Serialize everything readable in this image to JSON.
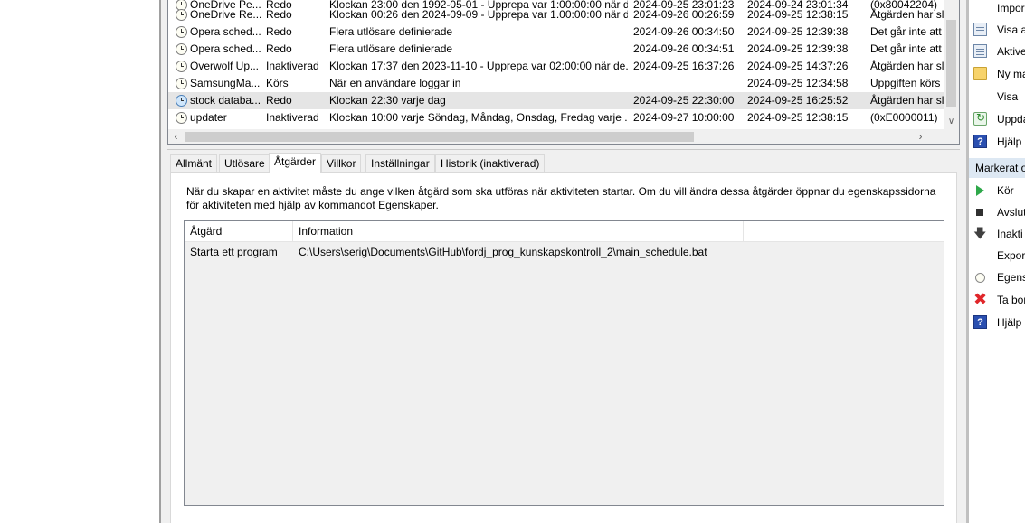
{
  "tasks": [
    {
      "name": "OneDrive Pe...",
      "status": "Redo",
      "trigger": "Klockan 23:00 den 1992-05-01 - Upprepa var 1:00:00:00 när di...",
      "next_run": "2024-09-25 23:01:23",
      "last_run": "2024-09-24 23:01:34",
      "result": "(0x80042204)",
      "selected": false,
      "icon": "clock-icon"
    },
    {
      "name": "OneDrive Re...",
      "status": "Redo",
      "trigger": "Klockan 00:26 den 2024-09-09 - Upprepa var 1.00:00:00 när d...",
      "next_run": "2024-09-26 00:26:59",
      "last_run": "2024-09-25 12:38:15",
      "result": "Åtgärden har sl",
      "selected": false,
      "icon": "clock-icon"
    },
    {
      "name": "Opera sched...",
      "status": "Redo",
      "trigger": "Flera utlösare definierade",
      "next_run": "2024-09-26 00:34:50",
      "last_run": "2024-09-25 12:39:38",
      "result": "Det går inte att",
      "selected": false,
      "icon": "clock-icon"
    },
    {
      "name": "Opera sched...",
      "status": "Redo",
      "trigger": "Flera utlösare definierade",
      "next_run": "2024-09-26 00:34:51",
      "last_run": "2024-09-25 12:39:38",
      "result": "Det går inte att",
      "selected": false,
      "icon": "clock-icon"
    },
    {
      "name": "Overwolf Up...",
      "status": "Inaktiverad",
      "trigger": "Klockan 17:37 den 2023-11-10 - Upprepa var 02:00:00 när de...",
      "next_run": "2024-09-25 16:37:26",
      "last_run": "2024-09-25 14:37:26",
      "result": "Åtgärden har sl",
      "selected": false,
      "icon": "clock-icon"
    },
    {
      "name": "SamsungMa...",
      "status": "Körs",
      "trigger": "När en användare loggar in",
      "next_run": "",
      "last_run": "2024-09-25 12:34:58",
      "result": "Uppgiften körs",
      "selected": false,
      "icon": "clock-icon"
    },
    {
      "name": "stock databa...",
      "status": "Redo",
      "trigger": "Klockan 22:30 varje dag",
      "next_run": "2024-09-25 22:30:00",
      "last_run": "2024-09-25 16:25:52",
      "result": "Åtgärden har sl",
      "selected": true,
      "icon": "clock-icon"
    },
    {
      "name": "updater",
      "status": "Inaktiverad",
      "trigger": "Klockan 10:00 varje Söndag, Måndag, Onsdag, Fredag varje ...",
      "next_run": "2024-09-27 10:00:00",
      "last_run": "2024-09-25 12:38:15",
      "result": "(0xE0000011)",
      "selected": false,
      "icon": "clock-icon"
    }
  ],
  "tabs": [
    {
      "label": "Allmänt",
      "active": false
    },
    {
      "label": "Utlösare",
      "active": false
    },
    {
      "label": "Åtgärder",
      "active": true
    },
    {
      "label": "Villkor",
      "active": false
    },
    {
      "label": "Inställningar",
      "active": false
    },
    {
      "label": "Historik (inaktiverad)",
      "active": false
    }
  ],
  "actions_tab": {
    "description": "När du skapar en aktivitet måste du ange vilken åtgärd som ska utföras när aktiviteten startar. Om du vill ändra dessa åtgärder öppnar du egenskapssidorna för aktiviteten med hjälp av kommandot Egenskaper.",
    "columns": [
      "Åtgärd",
      "Information"
    ],
    "rows": [
      {
        "action": "Starta ett program",
        "information": "C:\\Users\\serig\\Documents\\GitHub\\fordj_prog_kunskapskontroll_2\\main_schedule.bat"
      }
    ]
  },
  "right_pane": {
    "top_items": [
      {
        "label": "Impor",
        "icon": "import-icon"
      },
      {
        "label": "Visa a",
        "icon": "view-all-icon"
      },
      {
        "label": "Aktive",
        "icon": "enable-history-icon"
      },
      {
        "label": "Ny ma",
        "icon": "new-folder-icon"
      },
      {
        "label": "Visa",
        "icon": ""
      },
      {
        "label": "Uppda",
        "icon": "refresh-icon"
      },
      {
        "label": "Hjälp",
        "icon": "help-icon"
      }
    ],
    "section_header": "Markerat o",
    "selected_items": [
      {
        "label": "Kör",
        "icon": "run-icon"
      },
      {
        "label": "Avslut",
        "icon": "end-icon"
      },
      {
        "label": "Inakti",
        "icon": "disable-icon"
      },
      {
        "label": "Expor",
        "icon": ""
      },
      {
        "label": "Egens",
        "icon": "properties-icon"
      },
      {
        "label": "Ta bor",
        "icon": "delete-icon"
      },
      {
        "label": "Hjälp",
        "icon": "help-icon"
      }
    ]
  }
}
